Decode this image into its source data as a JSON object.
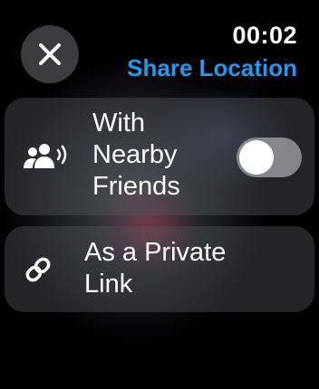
{
  "status": {
    "time": "00:02"
  },
  "header": {
    "title": "Share Location",
    "close_icon": "xmark-icon"
  },
  "options": [
    {
      "label": "With\nNearby\nFriends",
      "icon": "nearby-people-icon",
      "toggle": {
        "on": false
      }
    },
    {
      "label": "As a Private\nLink",
      "icon": "link-icon"
    }
  ],
  "colors": {
    "accent": "#1e9bf0",
    "toggle_off": "#96969c"
  }
}
